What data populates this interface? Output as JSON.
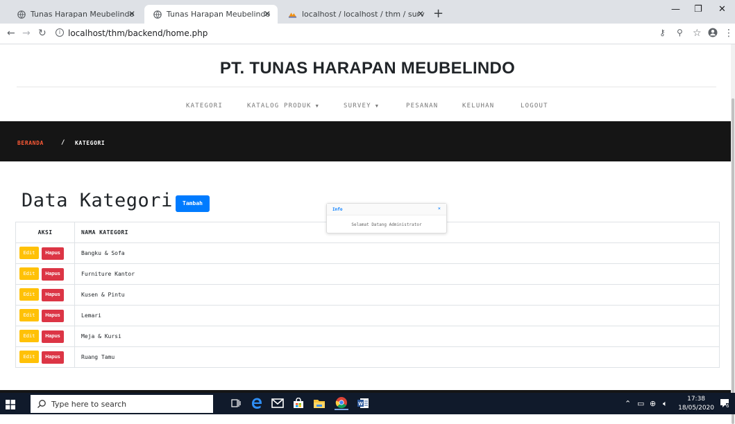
{
  "browser": {
    "tabs": [
      {
        "title": "Tunas Harapan Meubelindo"
      },
      {
        "title": "Tunas Harapan Meubelindo"
      },
      {
        "title": "localhost / localhost / thm / surv"
      }
    ],
    "url": "localhost/thm/backend/home.php"
  },
  "site": {
    "brand": "PT. TUNAS HARAPAN MEUBELINDO",
    "menu": [
      {
        "label": "KATEGORI"
      },
      {
        "label": "KATALOG PRODUK"
      },
      {
        "label": "SURVEY"
      },
      {
        "label": "PESANAN"
      },
      {
        "label": "KELUHAN"
      },
      {
        "label": "LOGOUT"
      }
    ]
  },
  "breadcrumb": {
    "home": "BERANDA",
    "separator": "/",
    "current": "KATEGORI"
  },
  "main": {
    "title": "Data Kategori",
    "add_label": "Tambah"
  },
  "toast": {
    "title": "Info",
    "close": "×",
    "message": "Selamat Datang Administrator"
  },
  "table": {
    "headers": {
      "aksi": "AKSI",
      "nama": "NAMA KATEGORI"
    },
    "edit_label": "Edit",
    "delete_label": "Hapus",
    "rows": [
      {
        "nama": "Bangku & Sofa"
      },
      {
        "nama": "Furniture Kantor"
      },
      {
        "nama": "Kusen & Pintu"
      },
      {
        "nama": "Lemari"
      },
      {
        "nama": "Meja & Kursi"
      },
      {
        "nama": "Ruang Tamu"
      }
    ]
  },
  "taskbar": {
    "search_placeholder": "Type here to search",
    "time": "17:38",
    "date": "18/05/2020",
    "notification_count": "6"
  },
  "colors": {
    "primary": "#007bff",
    "warning": "#ffc107",
    "danger": "#dc3545",
    "accent": "#ff5a36",
    "dark": "#151515"
  }
}
